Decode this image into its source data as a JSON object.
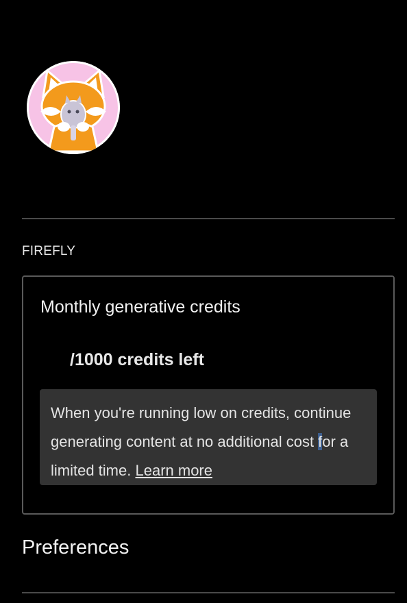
{
  "profile": {
    "avatar_icon": "fox-mascot-avatar-icon"
  },
  "firefly": {
    "section_label": "FIREFLY",
    "card": {
      "title": "Monthly generative credits",
      "credits_suffix": "/1000 credits left",
      "notice_before_mark": "When you're running low on credits, continue generating content at no additional cost ",
      "notice_mark": "f",
      "notice_after_mark": "or a limited time.",
      "learn_more": "Learn more"
    }
  },
  "preferences": {
    "title": "Preferences"
  },
  "colors": {
    "background": "#000000",
    "notice_background": "#333333",
    "divider": "#4a4a4a",
    "avatar_ring": "#f7c3e6",
    "fox_orange": "#f39a1c"
  }
}
